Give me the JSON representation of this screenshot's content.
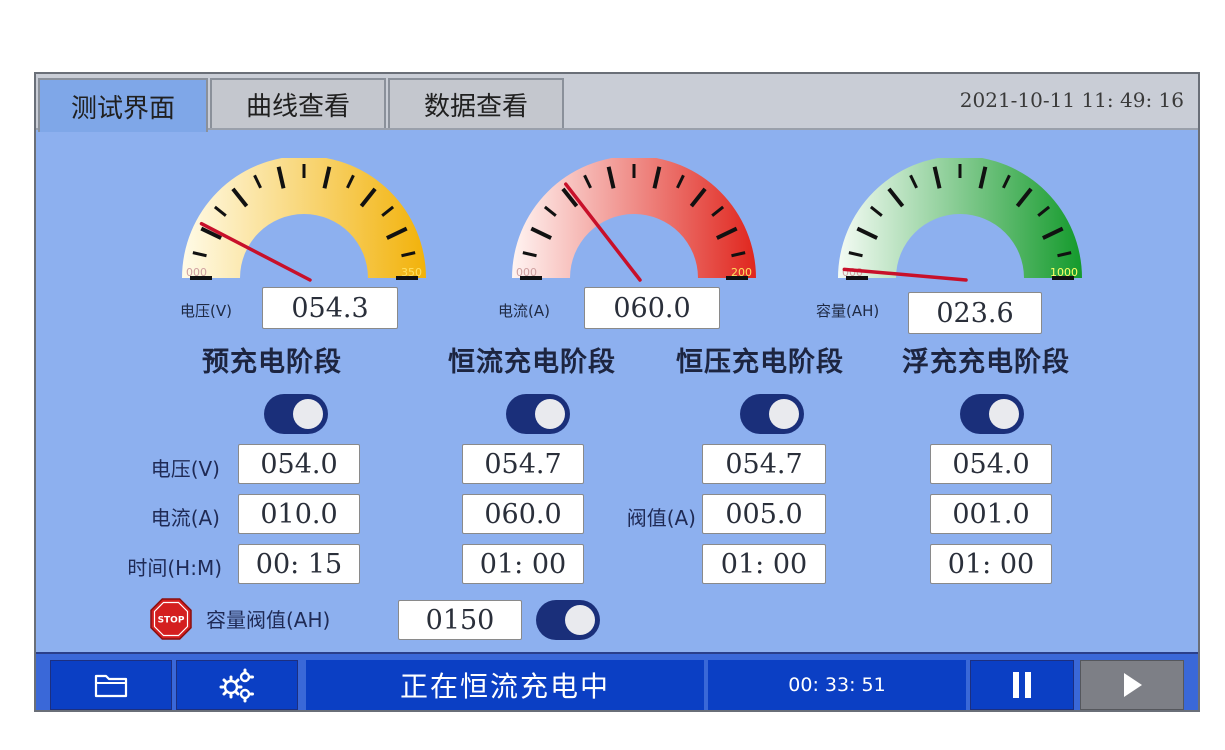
{
  "tabs": [
    {
      "label": "测试界面",
      "active": true
    },
    {
      "label": "曲线查看",
      "active": false
    },
    {
      "label": "数据查看",
      "active": false
    }
  ],
  "datetime": "2021-10-11  11: 49: 16",
  "gauges": [
    {
      "label": "电压(V)",
      "value": "054.3",
      "min": "000",
      "max": "350",
      "reading": 54.3,
      "range": [
        0,
        350
      ],
      "color_start": "#fffbe8",
      "color_end": "#f2b20a"
    },
    {
      "label": "电流(A)",
      "value": "060.0",
      "min": "000",
      "max": "200",
      "reading": 60.0,
      "range": [
        0,
        200
      ],
      "color_start": "#fff4f2",
      "color_end": "#e0261e"
    },
    {
      "label": "容量(AH)",
      "value": "023.6",
      "min": "000",
      "max": "1000",
      "reading": 23.6,
      "range": [
        0,
        1000
      ],
      "color_start": "#f4fbf4",
      "color_end": "#149a2c"
    }
  ],
  "stages": [
    {
      "title": "预充电阶段",
      "enabled": true,
      "voltage": "054.0",
      "current": "010.0",
      "time": "00: 15"
    },
    {
      "title": "恒流充电阶段",
      "enabled": true,
      "voltage": "054.7",
      "current": "060.0",
      "time": "01: 00"
    },
    {
      "title": "恒压充电阶段",
      "enabled": true,
      "voltage": "054.7",
      "current": "005.0",
      "time": "01: 00"
    },
    {
      "title": "浮充充电阶段",
      "enabled": true,
      "voltage": "054.0",
      "current": "001.0",
      "time": "01: 00"
    }
  ],
  "row_labels": {
    "voltage": "电压(V)",
    "current": "电流(A)",
    "time": "时间(H:M)",
    "threshold": "阀值(A)"
  },
  "capacity_threshold": {
    "label": "容量阀值(AH)",
    "value": "0150",
    "enabled": true,
    "stop_text": "STOP"
  },
  "bottom_bar": {
    "folder_icon": "folder-icon",
    "settings_icon": "gears-icon",
    "status_text": "正在恒流充电中",
    "elapsed": "00: 33: 51",
    "pause_icon": "pause-icon",
    "play_icon": "play-icon"
  },
  "colors": {
    "screen_bg": "#8db0ef",
    "bar_blue": "#0b3fc4",
    "toggle_track": "#1a2f7a"
  }
}
